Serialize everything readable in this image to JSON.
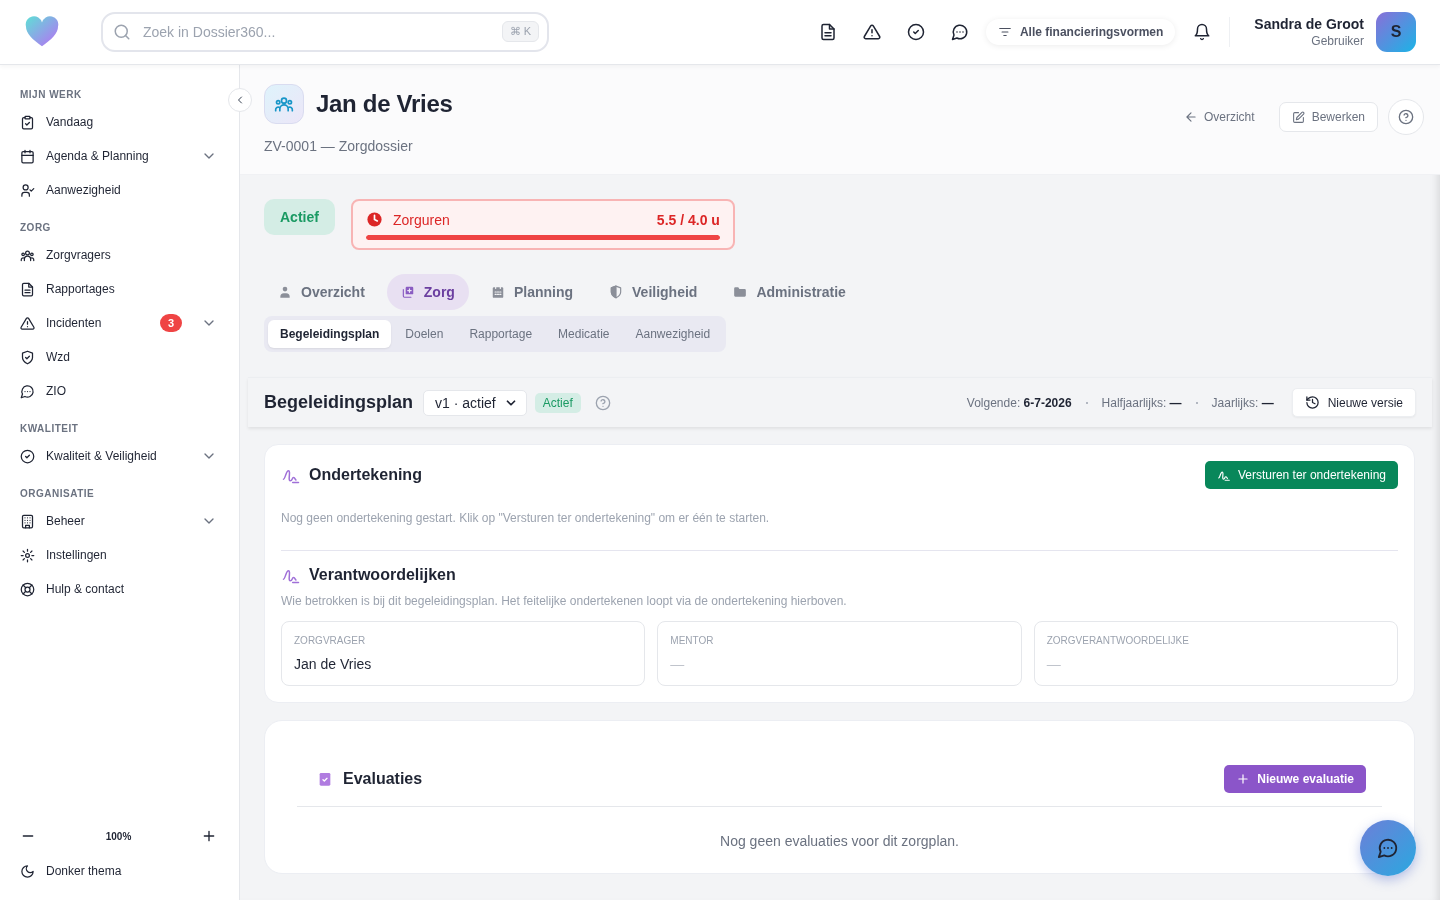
{
  "header": {
    "search": {
      "placeholder": "Zoek in Dossier360...",
      "shortcut": "⌘ K"
    },
    "filter": "Alle financieringsvormen",
    "user": {
      "name": "Sandra de Groot",
      "role": "Gebruiker",
      "initial": "S"
    }
  },
  "sidebar": {
    "sections": [
      {
        "title": "MIJN WERK",
        "items": [
          {
            "label": "Vandaag"
          },
          {
            "label": "Agenda & Planning",
            "expanded": false
          },
          {
            "label": "Aanwezigheid"
          }
        ]
      },
      {
        "title": "ZORG",
        "items": [
          {
            "label": "Zorgvragers"
          },
          {
            "label": "Rapportages"
          },
          {
            "label": "Incidenten",
            "badge": "3",
            "expanded": false
          },
          {
            "label": "Wzd"
          },
          {
            "label": "ZIO"
          }
        ]
      },
      {
        "title": "KWALITEIT",
        "items": [
          {
            "label": "Kwaliteit & Veiligheid",
            "expanded": false
          }
        ]
      },
      {
        "title": "ORGANISATIE",
        "items": [
          {
            "label": "Beheer",
            "expanded": false
          },
          {
            "label": "Instellingen"
          },
          {
            "label": "Hulp & contact"
          }
        ]
      }
    ],
    "zoom": "100%",
    "theme": "Donker thema"
  },
  "client": {
    "name": "Jan de Vries",
    "subtitle": "ZV-0001 — Zorgdossier",
    "back": "Overzicht",
    "edit": "Bewerken"
  },
  "status": "Actief",
  "hours": {
    "label": "Zorguren",
    "reading": "5.5 / 4.0 u",
    "level": 1,
    "over": true
  },
  "tabs": [
    {
      "label": "Overzicht",
      "selected": false
    },
    {
      "label": "Zorg",
      "selected": true
    },
    {
      "label": "Planning",
      "selected": false
    },
    {
      "label": "Veiligheid",
      "selected": false
    },
    {
      "label": "Administratie",
      "selected": false
    }
  ],
  "subtabs": [
    {
      "label": "Begeleidingsplan",
      "selected": true
    },
    {
      "label": "Doelen",
      "selected": false
    },
    {
      "label": "Rapportage",
      "selected": false
    },
    {
      "label": "Medicatie",
      "selected": false
    },
    {
      "label": "Aanwezigheid",
      "selected": false
    }
  ],
  "plan": {
    "title": "Begeleidingsplan",
    "version": "v1 · actief",
    "status": "Actief",
    "schedule": [
      "Volgende: **6-7-2026**",
      "Halfjaarlijks: **—**",
      "Jaarlijks: **—**"
    ],
    "new_version": "Nieuwe versie"
  },
  "signing": {
    "title": "Ondertekening",
    "button": "Versturen ter ondertekening",
    "empty": "Nog geen ondertekening gestart. Klik op \"Versturen ter ondertekening\" om er één te starten."
  },
  "responsible": {
    "title": "Verantwoordelijken",
    "description": "Wie betrokken is bij dit begeleidingsplan. Het feitelijke ondertekenen loopt via de ondertekening hierboven.",
    "roles": [
      {
        "label": "ZORGVRAGER",
        "value": "Jan de Vries"
      },
      {
        "label": "MENTOR",
        "value": "—"
      },
      {
        "label": "ZORGVERANTWOORDELIJKE",
        "value": "—"
      }
    ]
  },
  "evaluations": {
    "title": "Evaluaties",
    "button": "Nieuwe evaluatie",
    "empty": "Nog geen evaluaties voor dit zorgplan."
  }
}
